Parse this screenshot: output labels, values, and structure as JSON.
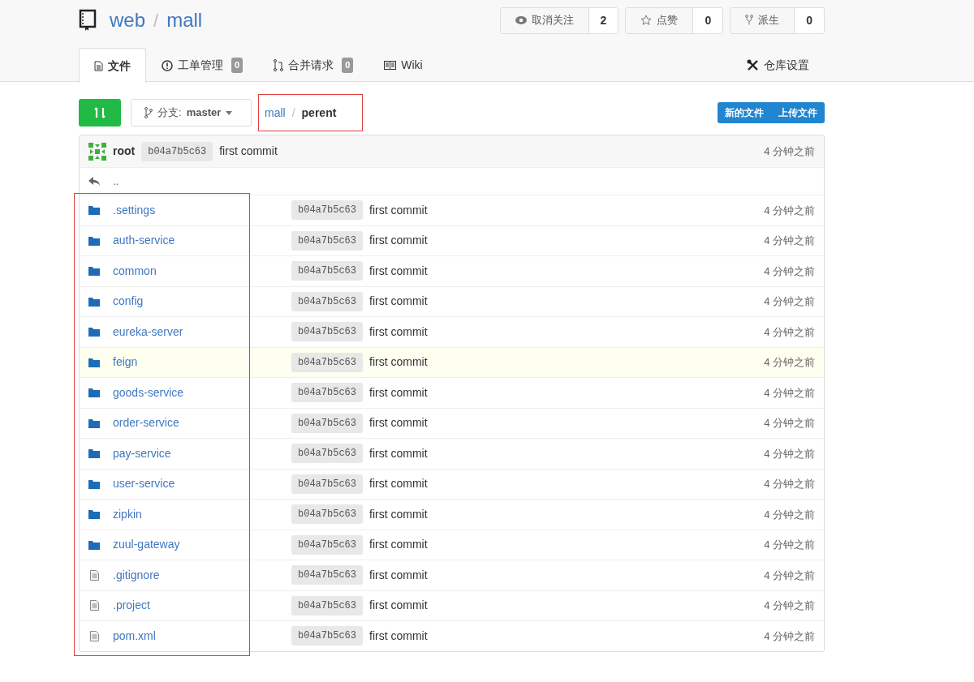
{
  "repo": {
    "owner": "web",
    "separator": "/",
    "name": "mall"
  },
  "repo_actions": [
    {
      "label": "取消关注",
      "count": "2",
      "kind": "watch"
    },
    {
      "label": "点赞",
      "count": "0",
      "kind": "star"
    },
    {
      "label": "派生",
      "count": "0",
      "kind": "fork"
    }
  ],
  "tabs": [
    {
      "label": "文件",
      "kind": "file",
      "selected": true
    },
    {
      "label": "工单管理",
      "badge": "0",
      "kind": "issue",
      "selected": false
    },
    {
      "label": "合并请求",
      "badge": "0",
      "kind": "pull",
      "selected": false
    },
    {
      "label": "Wiki",
      "kind": "wiki",
      "selected": false
    }
  ],
  "settings_tab": {
    "label": "仓库设置"
  },
  "branch": {
    "prefix": "分支:",
    "name": "master"
  },
  "breadcrumb": {
    "items": [
      "mall",
      "perent"
    ],
    "separator": "/"
  },
  "file_buttons": [
    "新的文件",
    "上传文件"
  ],
  "latest_commit": {
    "author": "root",
    "sha": "b04a7b5c63",
    "message": "first commit",
    "time": "4 分钟之前"
  },
  "parent_link": "..",
  "files": [
    {
      "name": ".settings",
      "kind": "folder",
      "sha": "b04a7b5c63",
      "message": "first commit",
      "time": "4 分钟之前",
      "highlighted": false
    },
    {
      "name": "auth-service",
      "kind": "folder",
      "sha": "b04a7b5c63",
      "message": "first commit",
      "time": "4 分钟之前",
      "highlighted": false
    },
    {
      "name": "common",
      "kind": "folder",
      "sha": "b04a7b5c63",
      "message": "first commit",
      "time": "4 分钟之前",
      "highlighted": false
    },
    {
      "name": "config",
      "kind": "folder",
      "sha": "b04a7b5c63",
      "message": "first commit",
      "time": "4 分钟之前",
      "highlighted": false
    },
    {
      "name": "eureka-server",
      "kind": "folder",
      "sha": "b04a7b5c63",
      "message": "first commit",
      "time": "4 分钟之前",
      "highlighted": false
    },
    {
      "name": "feign",
      "kind": "folder",
      "sha": "b04a7b5c63",
      "message": "first commit",
      "time": "4 分钟之前",
      "highlighted": true
    },
    {
      "name": "goods-service",
      "kind": "folder",
      "sha": "b04a7b5c63",
      "message": "first commit",
      "time": "4 分钟之前",
      "highlighted": false
    },
    {
      "name": "order-service",
      "kind": "folder",
      "sha": "b04a7b5c63",
      "message": "first commit",
      "time": "4 分钟之前",
      "highlighted": false
    },
    {
      "name": "pay-service",
      "kind": "folder",
      "sha": "b04a7b5c63",
      "message": "first commit",
      "time": "4 分钟之前",
      "highlighted": false
    },
    {
      "name": "user-service",
      "kind": "folder",
      "sha": "b04a7b5c63",
      "message": "first commit",
      "time": "4 分钟之前",
      "highlighted": false
    },
    {
      "name": "zipkin",
      "kind": "folder",
      "sha": "b04a7b5c63",
      "message": "first commit",
      "time": "4 分钟之前",
      "highlighted": false
    },
    {
      "name": "zuul-gateway",
      "kind": "folder",
      "sha": "b04a7b5c63",
      "message": "first commit",
      "time": "4 分钟之前",
      "highlighted": false
    },
    {
      "name": ".gitignore",
      "kind": "file",
      "sha": "b04a7b5c63",
      "message": "first commit",
      "time": "4 分钟之前",
      "highlighted": false
    },
    {
      "name": ".project",
      "kind": "file",
      "sha": "b04a7b5c63",
      "message": "first commit",
      "time": "4 分钟之前",
      "highlighted": false
    },
    {
      "name": "pom.xml",
      "kind": "file",
      "sha": "b04a7b5c63",
      "message": "first commit",
      "time": "4 分钟之前",
      "highlighted": false
    }
  ]
}
